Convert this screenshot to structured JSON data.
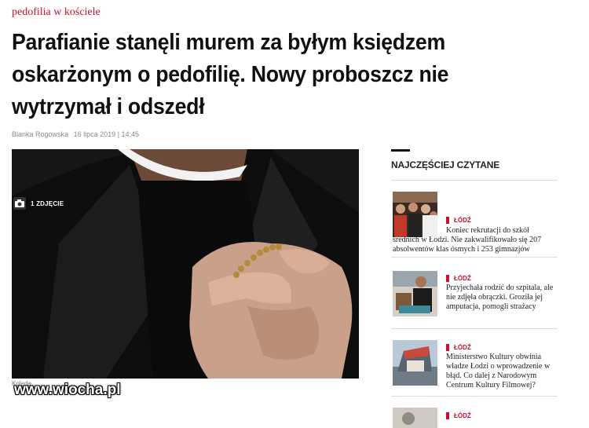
{
  "article": {
    "category": "pedofilia w kościele",
    "headline": "Parafianie stanęli murem za byłym księdzem oskarżonym o pedofilię. Nowy proboszcz nie wytrzymał i odszedł",
    "author": "Blanka Rogowska",
    "date": "16 lipca 2019 | 14:45",
    "photo_badge": "1 ZDJĘCIE",
    "photo_caption": "Kolęda"
  },
  "watermark": "www.wiocha.pl",
  "sidebar": {
    "title": "NAJCZĘŚCIEJ CZYTANE",
    "items": [
      {
        "tag": "ŁÓDŹ",
        "text": "Koniec rekrutacji do szkół średnich w Łodzi. Nie zakwalifikowało się 207 absolwentów klas ósmych i 253 gimnazjów"
      },
      {
        "tag": "ŁÓDŹ",
        "text": "Przyjechała rodzić do szpitala, ale nie zdjęła obrączki. Groziła jej amputacja, pomogli strażacy"
      },
      {
        "tag": "ŁÓDŹ",
        "text": "Ministerstwo Kultury obwinia władze Łodzi o wprowadzenie w błąd. Co dalej z Narodowym Centrum Kultury Filmowej?"
      },
      {
        "tag": "ŁÓDŹ",
        "text": ""
      }
    ]
  },
  "colors": {
    "accent": "#c8102e",
    "text": "#111111",
    "muted": "#888888"
  }
}
